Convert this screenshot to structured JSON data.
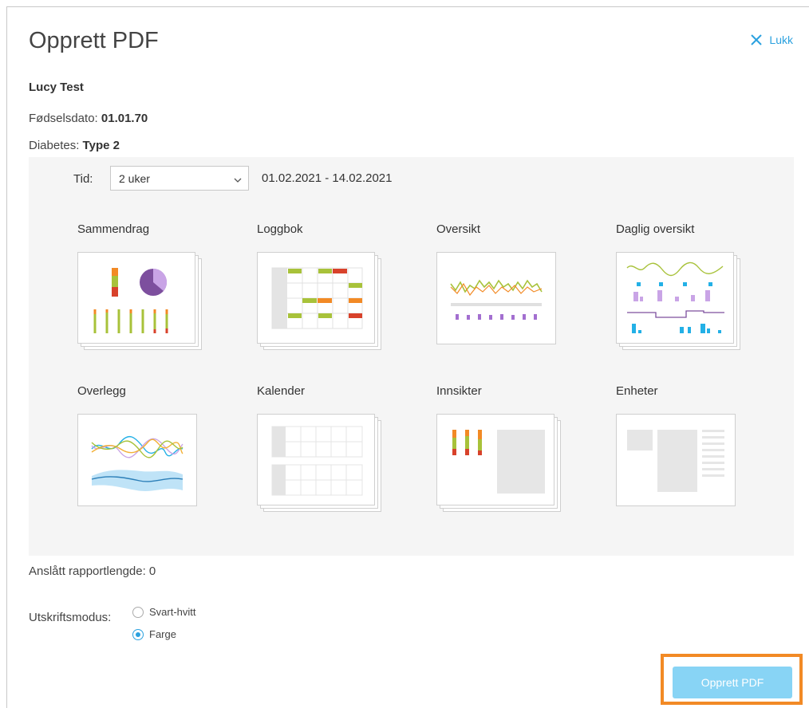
{
  "dialog": {
    "title": "Opprett PDF",
    "close_label": "Lukk"
  },
  "patient": {
    "name": "Lucy Test",
    "dob_label": "Fødselsdato:",
    "dob_value": "01.01.70",
    "diabetes_label": "Diabetes:",
    "diabetes_value": "Type 2"
  },
  "period": {
    "label": "Tid:",
    "selected": "2 uker",
    "range": "01.02.2021 - 14.02.2021"
  },
  "reports": [
    {
      "label": "Sammendrag",
      "icon": "summary-report-icon"
    },
    {
      "label": "Loggbok",
      "icon": "logbook-report-icon"
    },
    {
      "label": "Oversikt",
      "icon": "overview-report-icon"
    },
    {
      "label": "Daglig oversikt",
      "icon": "daily-overview-report-icon"
    },
    {
      "label": "Overlegg",
      "icon": "overlay-report-icon"
    },
    {
      "label": "Kalender",
      "icon": "calendar-report-icon"
    },
    {
      "label": "Innsikter",
      "icon": "insights-report-icon"
    },
    {
      "label": "Enheter",
      "icon": "devices-report-icon"
    }
  ],
  "estimate": {
    "text": "Anslått rapportlengde: 0"
  },
  "print_mode": {
    "label": "Utskriftsmodus:",
    "options": [
      {
        "label": "Svart-hvitt",
        "selected": false
      },
      {
        "label": "Farge",
        "selected": true
      }
    ]
  },
  "actions": {
    "create_label": "Opprett PDF"
  },
  "colors": {
    "accent": "#2ba1df",
    "button": "#88d4f5",
    "highlight": "#f28a25"
  }
}
